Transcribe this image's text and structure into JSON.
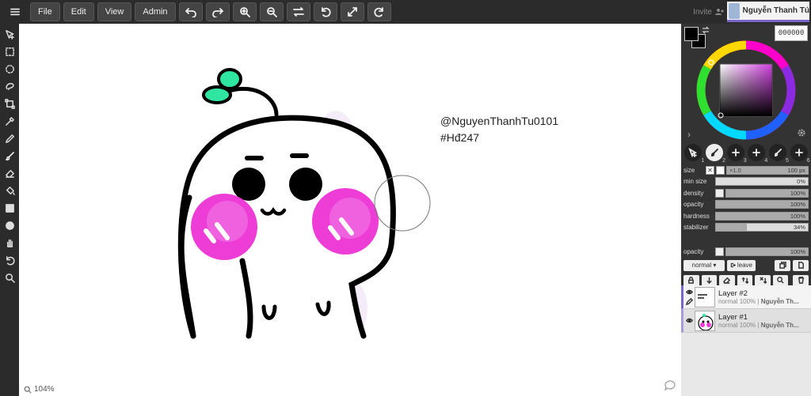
{
  "menu": {
    "hamburger": "☰",
    "file": "File",
    "edit": "Edit",
    "view": "View",
    "admin": "Admin"
  },
  "canvas": {
    "handle_line1": "@NguyenThanhTu0101",
    "handle_line2": "#Hđ247",
    "zoom": "104%"
  },
  "user": {
    "invite": "Invite",
    "name": "Nguyễn Thanh Tú"
  },
  "color": {
    "hex": "000000",
    "foreground": "#000000",
    "background": "#000000"
  },
  "brushes": [
    {
      "num": "1",
      "icon": "select-brush-icon"
    },
    {
      "num": "2",
      "icon": "paint-brush-icon",
      "active": true
    },
    {
      "num": "3",
      "icon": "plus-brush-icon"
    },
    {
      "num": "4",
      "icon": "plus-brush-icon"
    },
    {
      "num": "5",
      "icon": "brush-icon"
    },
    {
      "num": "6",
      "icon": "plus-brush-icon"
    }
  ],
  "sliders": {
    "size": {
      "label": "size",
      "multiplier": "×1.0",
      "value": "100 px",
      "level": 1.0
    },
    "min_size": {
      "label": "min size",
      "value": "0%",
      "level": 0.0
    },
    "density": {
      "label": "density",
      "value": "100%",
      "level": 1.0
    },
    "opacity": {
      "label": "opacity",
      "value": "100%",
      "level": 1.0
    },
    "hardness": {
      "label": "hardness",
      "value": "100%",
      "level": 1.0
    },
    "stabilizer": {
      "label": "stabilizer",
      "value": "34%",
      "level": 0.34
    }
  },
  "layer_opacity": {
    "label": "opacity",
    "value": "100%",
    "level": 1.0
  },
  "layer_controls": {
    "blend": "normal ▾",
    "leave": "leave"
  },
  "layers": [
    {
      "name": "Layer #2",
      "mode": "normal",
      "opacity": "100%",
      "owner": "Nguyễn Th..."
    },
    {
      "name": "Layer #1",
      "mode": "normal",
      "opacity": "100%",
      "owner": "Nguyễn Th..."
    }
  ]
}
